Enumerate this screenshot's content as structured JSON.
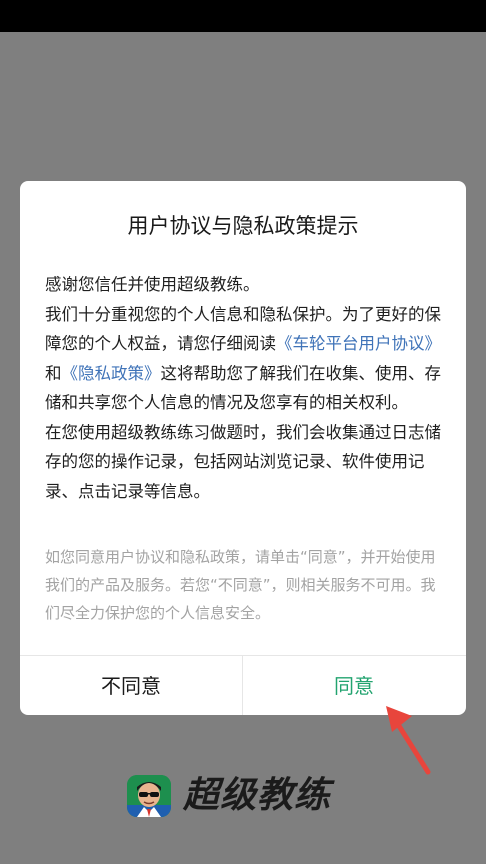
{
  "dialog": {
    "title": "用户协议与隐私政策提示",
    "greeting": "感谢您信任并使用超级教练。",
    "para1_a": "我们十分重视您的个人信息和隐私保护。为了更好的保障您的个人权益，请您仔细阅读",
    "link_user_agreement": "《车轮平台用户协议》",
    "and": "和",
    "link_privacy_policy": "《隐私政策》",
    "para1_b": "这将帮助您了解我们在收集、使用、存储和共享您个人信息的情况及您享有的相关权利。",
    "para2": "在您使用超级教练练习做题时，我们会收集通过日志储存的您的操作记录，包括网站浏览记录、软件使用记录、点击记录等信息。",
    "note": "如您同意用户协议和隐私政策，请单击“同意”，并开始使用我们的产品及服务。若您“不同意”，则相关服务不可用。我们尽全力保护您的个人信息安全。",
    "disagree_label": "不同意",
    "agree_label": "同意"
  },
  "brand": {
    "name": "超级教练",
    "logo_icon": "coach-avatar-icon"
  },
  "colors": {
    "accent": "#22a36f",
    "link": "#3f73b8",
    "arrow": "#e8453c"
  }
}
